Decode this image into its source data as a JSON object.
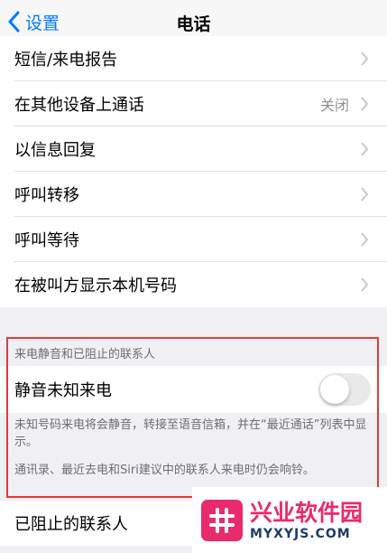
{
  "navbar": {
    "back_label": "设置",
    "title": "电话"
  },
  "settings_rows": [
    {
      "label": "短信/来电报告",
      "value": ""
    },
    {
      "label": "在其他设备上通话",
      "value": "关闭"
    },
    {
      "label": "以信息回复",
      "value": ""
    },
    {
      "label": "呼叫转移",
      "value": ""
    },
    {
      "label": "呼叫等待",
      "value": ""
    },
    {
      "label": "在被叫方显示本机号码",
      "value": ""
    }
  ],
  "silence_section": {
    "header": "来电静音和已阻止的联系人",
    "toggle_label": "静音未知来电",
    "toggle_on": false,
    "footer_line1": "未知号码来电将会静音，转接至语音信箱，并在“最近通话”列表中显示。",
    "footer_line2": "通讯录、最近去电和Siri建议中的联系人来电时仍会响铃。"
  },
  "blocked_row": {
    "label": "已阻止的联系人"
  },
  "watermark": {
    "title": "兴业软件园",
    "url": "MYXYJS.COM"
  },
  "colors": {
    "accent": "#007aff",
    "highlight_border": "#e53935",
    "watermark": "#e62b6e"
  }
}
